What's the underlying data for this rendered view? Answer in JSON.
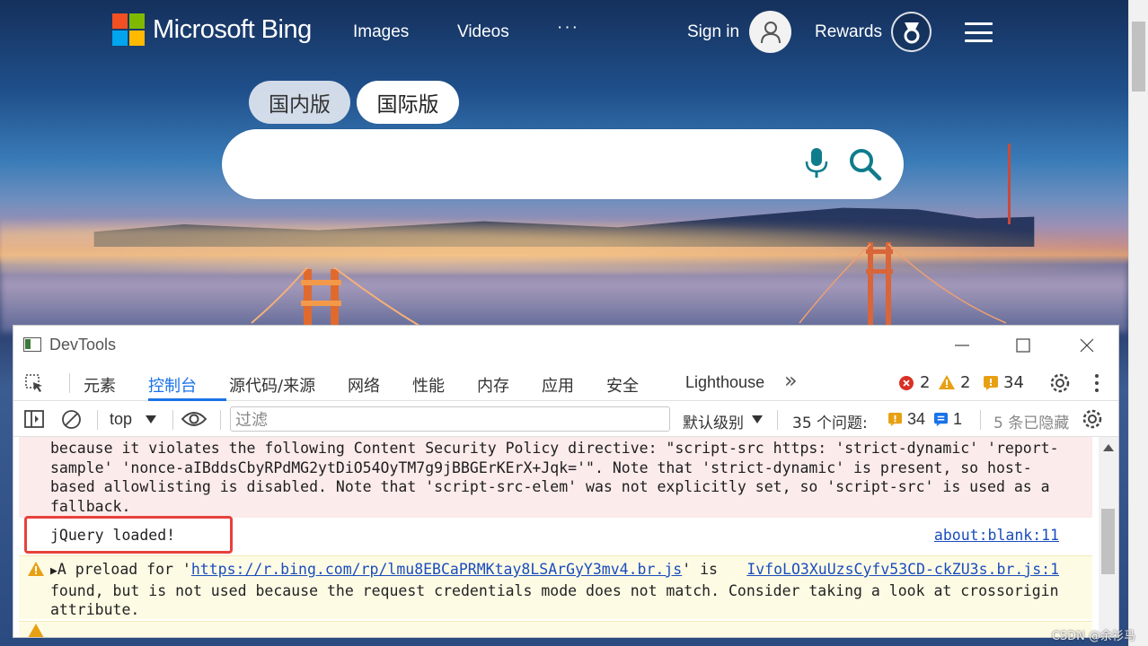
{
  "bing": {
    "logo_text": "Microsoft Bing",
    "nav": [
      "Images",
      "Videos",
      "···"
    ],
    "sign_in": "Sign in",
    "rewards": "Rewards",
    "region_tabs": [
      {
        "label": "国内版",
        "active": false
      },
      {
        "label": "国际版",
        "active": true
      }
    ],
    "search_value": "",
    "accent_color": "#0f7c8c"
  },
  "devtools": {
    "title": "DevTools",
    "tabs": [
      "元素",
      "控制台",
      "源代码/来源",
      "网络",
      "性能",
      "内存",
      "应用",
      "安全",
      "Lighthouse"
    ],
    "active_tab": "控制台",
    "more_tabs": "»",
    "counts": {
      "errors": "2",
      "warnings": "2",
      "issues": "34"
    },
    "toolbar": {
      "context": "top",
      "filter_placeholder": "过滤",
      "level": "默认级别",
      "issues_label": "35 个问题:",
      "issues_warn": "34",
      "issues_info": "1",
      "hidden": "5 条已隐藏"
    },
    "console": {
      "error_lines": [
        "because it violates the following Content Security Policy directive: \"script-src https: 'strict-dynamic' 'report-",
        "sample' 'nonce-aIBddsCbyRPdMG2ytDiO54OyTM7g9jBBGErKErX+Jqk='\". Note that 'strict-dynamic' is present, so host-",
        "based allowlisting is disabled. Note that 'script-src-elem' was not explicitly set, so 'script-src' is used as a",
        "fallback."
      ],
      "log_text": "jQuery loaded!",
      "log_source": "about:blank:11",
      "warn_prefix": "A preload for '",
      "warn_link": "https://r.bing.com/rp/lmu8EBCaPRMKtay8LSArGyY3mv4.br.js",
      "warn_mid": "' is",
      "warn_source": "IvfoLO3XuUzsCyfv53CD-ckZU3s.br.js:1",
      "warn_line2": "found, but is not used because the request credentials mode does not match. Consider taking a look at crossorigin",
      "warn_line3": "attribute."
    }
  },
  "watermark": "CSDN @余衫马"
}
